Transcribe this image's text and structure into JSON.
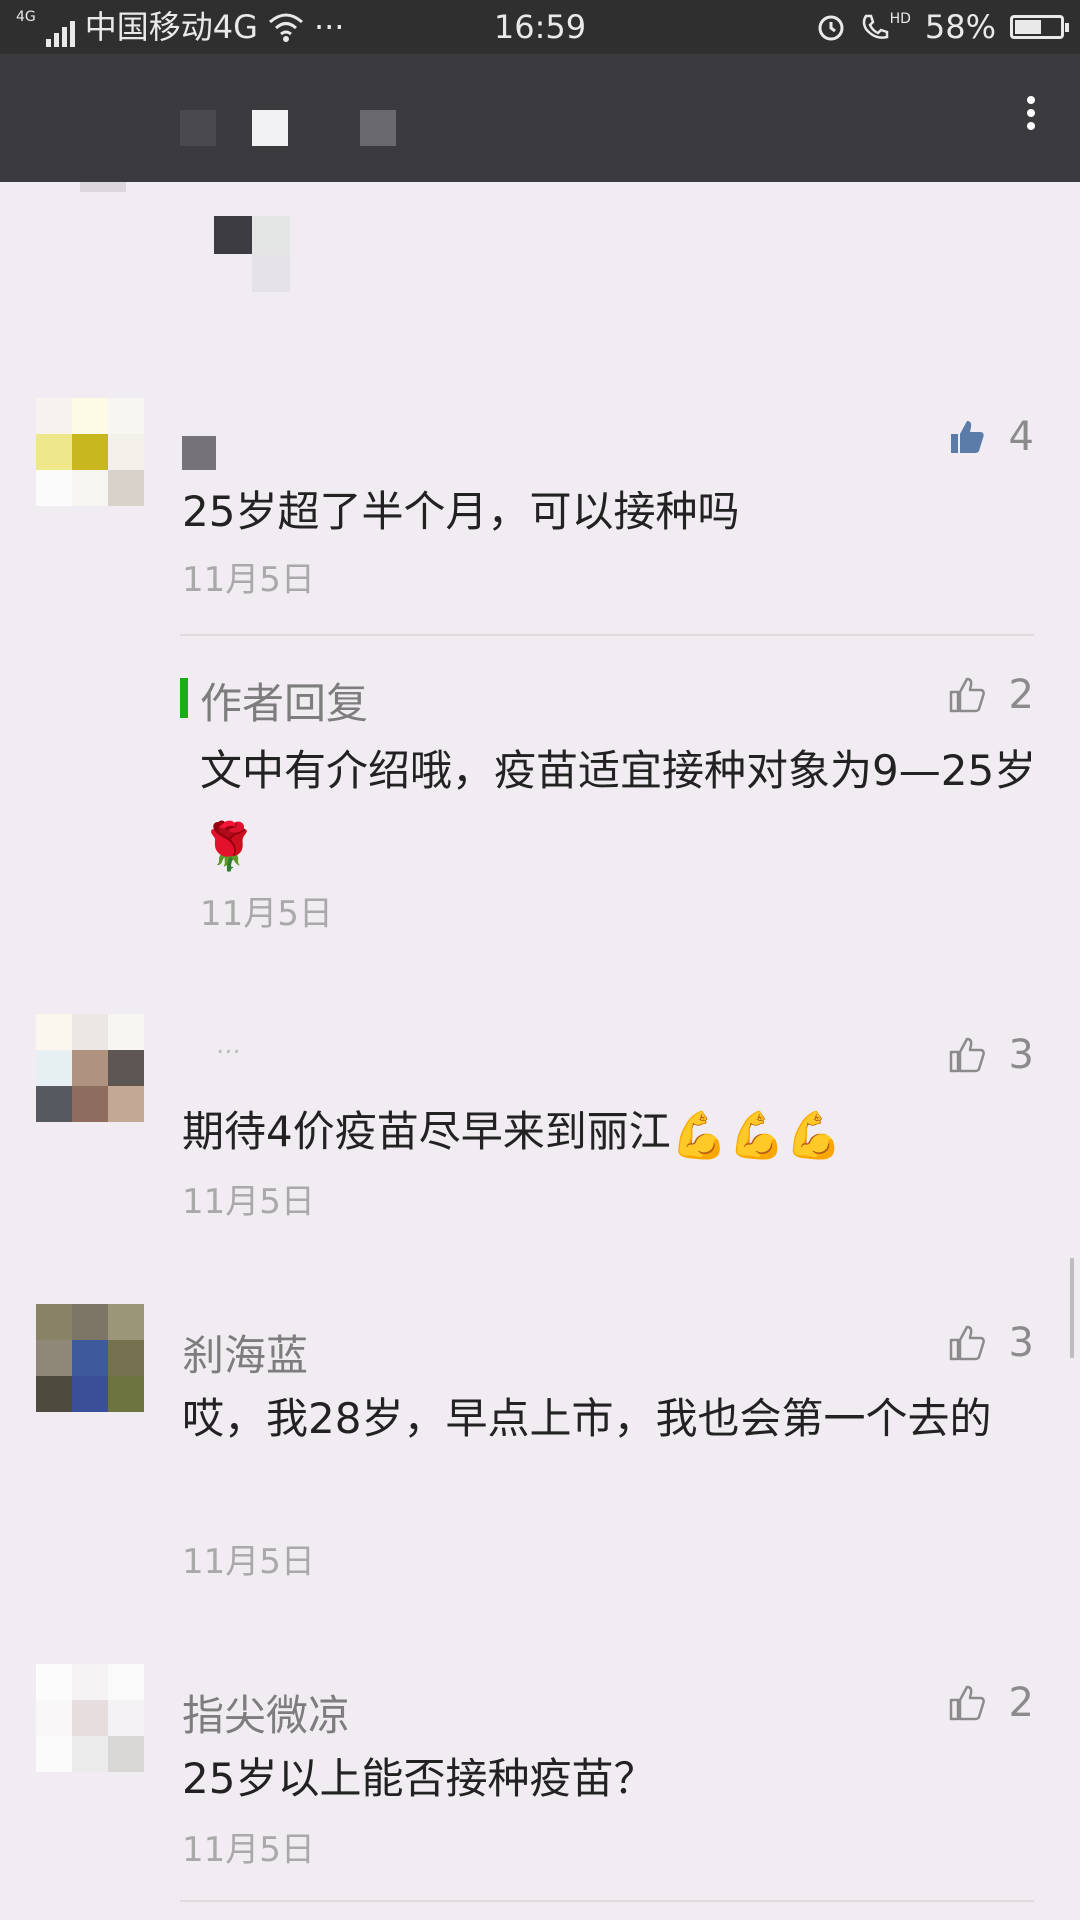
{
  "status_bar": {
    "network_badge": "4G",
    "carrier": "中国移动4G",
    "more": "···",
    "time": "16:59",
    "hd_label": "HD",
    "battery": "58%",
    "battery_level": 0.58
  },
  "comments": [
    {
      "name": "",
      "text": "25岁超了半个月，可以接种吗",
      "date": "11月5日",
      "likes": "4",
      "liked": true
    },
    {
      "reply_label": "作者回复",
      "text": "文中有介绍哦，疫苗适宜接种对象为9—25岁",
      "emoji": "🌹",
      "date": "11月5日",
      "likes": "2"
    },
    {
      "name": "...",
      "text": "期待4价疫苗尽早来到丽江",
      "emoji": "💪💪💪",
      "date": "11月5日",
      "likes": "3"
    },
    {
      "name": "刹海蓝",
      "text": "哎，我28岁，早点上市，我也会第一个去的",
      "date": "11月5日",
      "likes": "3"
    },
    {
      "name": "指尖微凉",
      "text": "25岁以上能否接种疫苗？",
      "date": "11月5日",
      "likes": "2"
    }
  ],
  "colors": {
    "accent_green": "#1aad19",
    "like_active": "#5b7ba8",
    "like_idle": "#8b8b8b"
  }
}
